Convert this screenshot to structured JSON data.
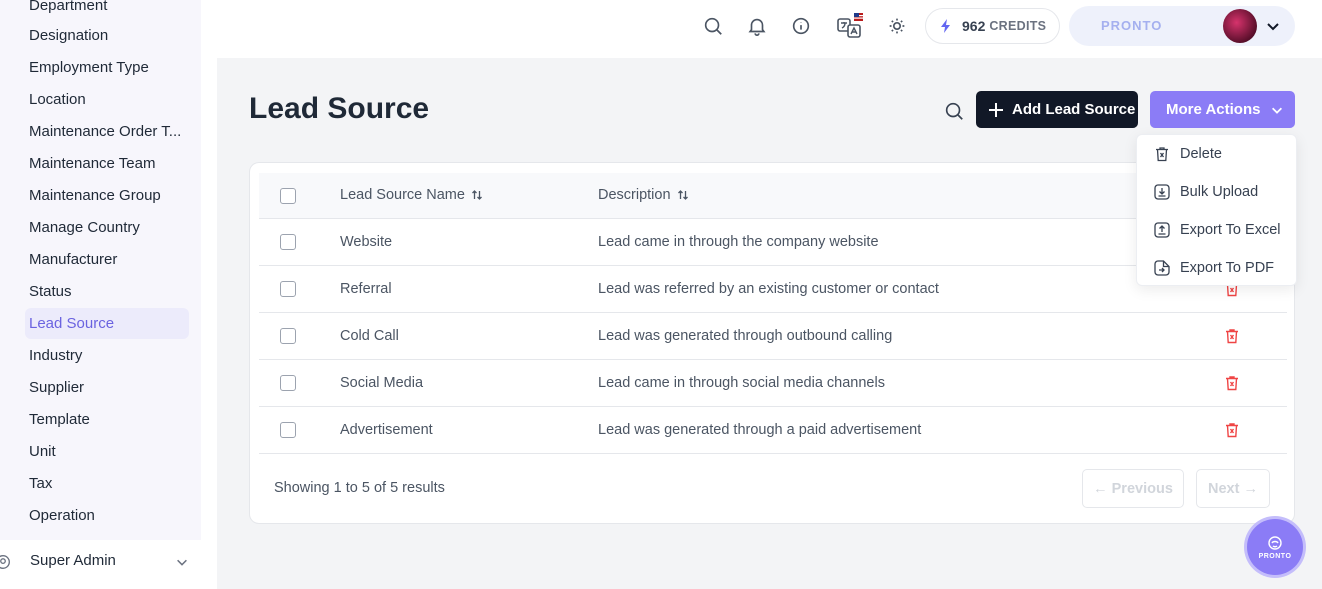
{
  "sidebar": {
    "items": [
      {
        "label": "Department"
      },
      {
        "label": "Designation"
      },
      {
        "label": "Employment Type"
      },
      {
        "label": "Location"
      },
      {
        "label": "Maintenance Order T..."
      },
      {
        "label": "Maintenance Team"
      },
      {
        "label": "Maintenance Group"
      },
      {
        "label": "Manage Country"
      },
      {
        "label": "Manufacturer"
      },
      {
        "label": "Status"
      },
      {
        "label": "Lead Source",
        "active": true
      },
      {
        "label": "Industry"
      },
      {
        "label": "Supplier"
      },
      {
        "label": "Template"
      },
      {
        "label": "Unit"
      },
      {
        "label": "Tax"
      },
      {
        "label": "Operation"
      }
    ],
    "user_role": "Super Admin"
  },
  "topbar": {
    "credits_value": "962",
    "credits_label": "CREDITS",
    "brand": "PRONTO",
    "icons": [
      "search-icon",
      "bell-icon",
      "info-icon",
      "translate-icon",
      "sun-icon"
    ]
  },
  "page": {
    "title": "Lead Source",
    "add_button_label": "Add Lead Source",
    "more_actions_label": "More Actions"
  },
  "table": {
    "columns": [
      "Lead Source Name",
      "Description"
    ],
    "rows": [
      {
        "name": "Website",
        "description": "Lead came in through the company website"
      },
      {
        "name": "Referral",
        "description": "Lead was referred by an existing customer or contact"
      },
      {
        "name": "Cold Call",
        "description": "Lead was generated through outbound calling"
      },
      {
        "name": "Social Media",
        "description": "Lead came in through social media channels"
      },
      {
        "name": "Advertisement",
        "description": "Lead was generated through a paid advertisement"
      }
    ],
    "showing_text": "Showing 1 to 5 of 5 results",
    "previous_label": "← Previous",
    "next_label": "Next →"
  },
  "dropdown": {
    "items": [
      {
        "label": "Delete",
        "icon": "trash-icon"
      },
      {
        "label": "Bulk Upload",
        "icon": "download-icon"
      },
      {
        "label": "Export To Excel",
        "icon": "upload-icon"
      },
      {
        "label": "Export To PDF",
        "icon": "file-export-icon"
      }
    ]
  },
  "fab": {
    "label": "PRONTO"
  },
  "colors": {
    "accent": "#8b7cf6",
    "active_sidebar_bg": "#ecebfb",
    "active_sidebar_text": "#6b63e0",
    "dark_button": "#111827",
    "danger": "#ef4444"
  }
}
